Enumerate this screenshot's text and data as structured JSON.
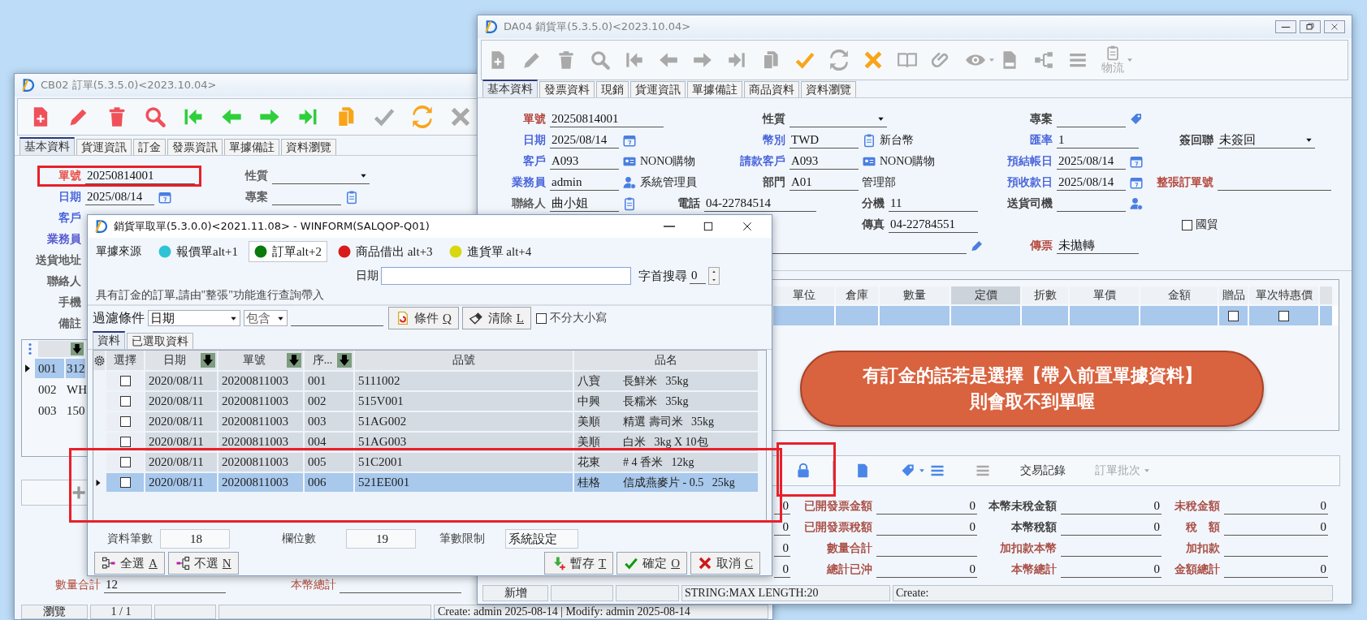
{
  "order_window": {
    "title": "CB02 訂單(5.3.5.0)<2023.10.04>",
    "toolbar": [
      {
        "kind": "new",
        "disabled": false
      },
      {
        "kind": "edit",
        "disabled": false
      },
      {
        "kind": "delete",
        "disabled": false
      },
      {
        "kind": "search",
        "disabled": false
      },
      {
        "kind": "first",
        "disabled": false
      },
      {
        "kind": "prev",
        "disabled": false
      },
      {
        "kind": "next",
        "disabled": false
      },
      {
        "kind": "last",
        "disabled": false
      },
      {
        "kind": "copy",
        "disabled": false
      },
      {
        "kind": "confirm",
        "disabled": true
      },
      {
        "kind": "refresh",
        "disabled": false
      },
      {
        "kind": "cancel",
        "disabled": true
      }
    ],
    "tabs": [
      {
        "label": "基本資料",
        "selected": true
      },
      {
        "label": "貨運資訊",
        "selected": false
      },
      {
        "label": "訂金",
        "selected": false
      },
      {
        "label": "發票資訊",
        "selected": false
      },
      {
        "label": "單據備註",
        "selected": false
      },
      {
        "label": "資料瀏覽",
        "selected": false
      }
    ],
    "fields": [
      {
        "kind": "standard",
        "cells": [
          {
            "label": "單號",
            "color": "#e8433a",
            "kind": "text",
            "value": "20250814001",
            "highlighted": true
          },
          {
            "label": "性質",
            "color": "#555555",
            "kind": "select"
          }
        ]
      },
      {
        "kind": "standard",
        "cells": [
          {
            "label": "日期",
            "color": "#3d5bd9",
            "kind": "date",
            "value": "2025/08/14"
          },
          {
            "label": "專案",
            "color": "#555555",
            "kind": "memo"
          }
        ]
      },
      {
        "kind": "standard",
        "cells": [
          {
            "label": "客戶",
            "color": "#3d5bd9",
            "kind": "label"
          }
        ]
      },
      {
        "kind": "standard",
        "cells": [
          {
            "label": "業務員",
            "color": "#4a4fd0",
            "kind": "label"
          }
        ]
      },
      {
        "kind": "standard",
        "cells": [
          {
            "label": "送貨地址",
            "color": "#555555",
            "kind": "label"
          }
        ]
      },
      {
        "kind": "standard",
        "cells": [
          {
            "label": "聯絡人",
            "color": "#555555",
            "kind": "label"
          }
        ]
      },
      {
        "kind": "standard",
        "cells": [
          {
            "label": "手機",
            "color": "#555555",
            "kind": "label"
          }
        ]
      },
      {
        "kind": "standard",
        "cells": [
          {
            "label": "備註",
            "color": "#555555",
            "kind": "label"
          }
        ]
      }
    ],
    "lines": [
      {
        "seq": "001",
        "value": "312",
        "selected": true
      },
      {
        "seq": "002",
        "value": "WH",
        "selected": false
      },
      {
        "seq": "003",
        "value": "150",
        "selected": false
      }
    ],
    "totals": [
      {
        "label": "數量合計",
        "color": "#b04a3a",
        "value": "12"
      },
      {
        "label": "本幣總計",
        "color": "#b04a3a"
      }
    ],
    "status_bar": {
      "mode": "瀏覽",
      "position": "1 / 1",
      "info": "Create: admin 2025-08-14 | Modify: admin 2025-08-14"
    }
  },
  "sales_window": {
    "title": "DA04 銷貨單(5.3.5.0)<2023.10.04>",
    "toolbar": [
      {
        "kind": "new",
        "disabled": true
      },
      {
        "kind": "edit",
        "disabled": true
      },
      {
        "kind": "delete",
        "disabled": true
      },
      {
        "kind": "search",
        "disabled": true
      },
      {
        "kind": "first",
        "disabled": true
      },
      {
        "kind": "prev",
        "disabled": true
      },
      {
        "kind": "next",
        "disabled": true
      },
      {
        "kind": "last",
        "disabled": true
      },
      {
        "kind": "copy",
        "disabled": true
      },
      {
        "kind": "confirm",
        "disabled": false
      },
      {
        "kind": "refresh",
        "disabled": true
      },
      {
        "kind": "cancel",
        "disabled": false
      },
      {
        "kind": "book",
        "disabled": true
      },
      {
        "kind": "clip",
        "disabled": true
      },
      {
        "kind": "view",
        "disabled": true,
        "dropdown": true
      },
      {
        "kind": "xls",
        "disabled": true
      },
      {
        "kind": "tree",
        "disabled": true
      },
      {
        "kind": "list",
        "disabled": true
      },
      {
        "kind": "logistics",
        "disabled": true,
        "dropdown": true,
        "label": "物流"
      }
    ],
    "tabs": [
      {
        "label": "基本資料",
        "selected": true
      },
      {
        "label": "發票資料",
        "selected": false
      },
      {
        "label": "現銷",
        "selected": false
      },
      {
        "label": "貨運資訊",
        "selected": false
      },
      {
        "label": "單據備註",
        "selected": false
      },
      {
        "label": "商品資料",
        "selected": false
      },
      {
        "label": "資料瀏覽",
        "selected": false
      }
    ],
    "fields": [
      {
        "kind": "standard",
        "cells": [
          {
            "label": "單號",
            "color": "#b03a2e",
            "kind": "text",
            "value": "20250814001"
          },
          {
            "label": "性質",
            "color": "#333333",
            "kind": "select"
          },
          {
            "label": "專案",
            "color": "#333333",
            "kind": "project"
          },
          null
        ]
      },
      {
        "kind": "standard",
        "cells": [
          {
            "label": "日期",
            "color": "#3d5bd9",
            "kind": "date",
            "value": "2025/08/14"
          },
          {
            "label": "幣別",
            "color": "#3d5bd9",
            "kind": "memo",
            "value": "TWD",
            "note": "新台幣"
          },
          {
            "label": "匯率",
            "color": "#3d5bd9",
            "kind": "text",
            "value": "1"
          },
          {
            "label": "簽回聯",
            "color": "#333333",
            "kind": "select",
            "value": "未簽回"
          }
        ]
      },
      {
        "kind": "standard",
        "cells": [
          {
            "label": "客戶",
            "color": "#3d5bd9",
            "kind": "lookup",
            "value": "A093",
            "note": "NONO購物"
          },
          {
            "label": "請款客戶",
            "color": "#3d5bd9",
            "kind": "lookup",
            "value": "A093",
            "note": "NONO購物"
          },
          {
            "label": "預結帳日",
            "color": "#3d5bd9",
            "kind": "date",
            "value": "2025/08/14"
          },
          null
        ]
      },
      {
        "kind": "standard",
        "cells": [
          {
            "label": "業務員",
            "color": "#3d5bd9",
            "kind": "user",
            "value": "admin",
            "note": "系統管理員"
          },
          {
            "label": "部門",
            "color": "#333333",
            "kind": "text",
            "value": "A01",
            "note": "管理部"
          },
          {
            "label": "預收款日",
            "color": "#3d5bd9",
            "kind": "date",
            "value": "2025/08/14"
          },
          {
            "label": "整張訂單號",
            "color": "#b03a2e",
            "kind": "text"
          }
        ]
      },
      {
        "kind": "contact",
        "cells": [
          {
            "label": "聯絡人",
            "color": "#555555",
            "kind": "memo",
            "value": "曲小姐"
          },
          {
            "label": "電話",
            "color": "#333333",
            "kind": "text",
            "value": "04-22784514"
          },
          {
            "label": "分機",
            "color": "#333333",
            "kind": "text",
            "value": "11"
          },
          {
            "label": "送貨司機",
            "color": "#333333",
            "kind": "user"
          }
        ]
      },
      {
        "kind": "contact",
        "cells": [
          null,
          null,
          {
            "label": "傳真",
            "color": "#333333",
            "kind": "text",
            "value": "04-22784551"
          },
          {
            "label": "國貿",
            "color": "#333333",
            "kind": "checkbox",
            "checked": false
          }
        ]
      },
      {
        "kind": "standard",
        "cells": [
          null,
          {
            "kind": "address"
          },
          {
            "label": "傳票",
            "color": "#b03a2e",
            "kind": "text",
            "value": "未拋轉"
          },
          null
        ]
      }
    ],
    "grid": {
      "columns": [
        {
          "label": "單位",
          "kind": "text",
          "selected": false
        },
        {
          "label": "倉庫",
          "kind": "text",
          "selected": false
        },
        {
          "label": "數量",
          "kind": "text",
          "selected": false
        },
        {
          "label": "定價",
          "kind": "text",
          "selected": true
        },
        {
          "label": "折數",
          "kind": "text",
          "selected": false
        },
        {
          "label": "單價",
          "kind": "text",
          "selected": false
        },
        {
          "label": "金額",
          "kind": "text",
          "selected": false
        },
        {
          "label": "贈品",
          "kind": "check",
          "selected": false
        },
        {
          "label": "單次特惠價",
          "kind": "check",
          "selected": false
        }
      ],
      "rows": [
        {
          "selected": true,
          "checks": [
            {
              "checked": false
            },
            {
              "checked": false
            }
          ]
        }
      ]
    },
    "bottom_toolbar": [
      {
        "kind": "lock",
        "disabled": false,
        "highlighted": true
      },
      {
        "kind": "doc",
        "disabled": false
      },
      {
        "kind": "tag",
        "disabled": false,
        "dropdown": true
      },
      {
        "kind": "list",
        "disabled": false
      },
      {
        "kind": "list",
        "disabled": true
      },
      {
        "kind": "text",
        "label": "交易記錄",
        "disabled": false
      },
      {
        "kind": "text",
        "label": "訂單批次",
        "disabled": true,
        "dropdown": true
      }
    ],
    "totals": {
      "column_1": [
        "0",
        "0",
        "0",
        "0"
      ],
      "rows": [
        [
          {
            "label": "已開發票金額",
            "color": "#a5443a",
            "value": "0"
          },
          {
            "label": "本幣未稅金額",
            "color": "#333333",
            "value": "0"
          },
          {
            "label": "未稅金額",
            "color": "#a5443a",
            "value": "0"
          }
        ],
        [
          {
            "label": "已開發票稅額",
            "color": "#a5443a",
            "value": "0"
          },
          {
            "label": "本幣稅額",
            "color": "#333333",
            "value": "0"
          },
          {
            "label": "稅　額",
            "color": "#a5443a",
            "value": "0"
          }
        ],
        [
          {
            "label": "數量合計",
            "color": "#a5443a"
          },
          {
            "label": "加扣款本幣",
            "color": "#a5443a"
          },
          {
            "label": "加扣款",
            "color": "#a5443a"
          }
        ],
        [
          {
            "label": "總計已沖",
            "color": "#a5443a",
            "value": "0"
          },
          {
            "label": "本幣總計",
            "color": "#a5443a",
            "value": "0"
          },
          {
            "label": "金額總計",
            "color": "#a5443a",
            "value": "0"
          }
        ]
      ]
    },
    "status_bar": {
      "mode": "新增",
      "message": "STRING:MAX LENGTH:20",
      "info": "Create:"
    }
  },
  "pick_dialog": {
    "title": "銷貨單取單(5.3.0.0)<2021.11.08> - WINFORM(SALQOP-Q01)",
    "source_label": "單據來源",
    "sources": [
      {
        "label": "報價單alt+1",
        "color": "#2ec4d6",
        "selected": false
      },
      {
        "label": "訂單alt+2",
        "color": "#0a7a0a",
        "selected": true
      },
      {
        "label": "商品借出 alt+3",
        "color": "#d81c1c",
        "selected": false
      },
      {
        "label": "進貨單 alt+4",
        "color": "#d8d810",
        "selected": false
      }
    ],
    "date_label": "日期",
    "prefix_search": {
      "label": "字首搜尋",
      "value": "0"
    },
    "note": "具有訂金的訂單,請由\"整張\"功能進行查詢帶入",
    "filter": {
      "label": "過濾條件",
      "field": "日期",
      "operator": "包含",
      "buttons": [
        {
          "kind": "condition",
          "label": "條件",
          "accel": "Q"
        },
        {
          "kind": "clear",
          "label": "清除",
          "accel": "L"
        }
      ],
      "ignore_case": {
        "label": "不分大小寫",
        "checked": false
      }
    },
    "tabs": [
      {
        "label": "資料",
        "selected": true
      },
      {
        "label": "已選取資料",
        "selected": false
      }
    ],
    "columns": [
      {
        "label": "選擇",
        "sortable": false
      },
      {
        "label": "日期",
        "sortable": true
      },
      {
        "label": "單號",
        "sortable": true
      },
      {
        "label": "序...",
        "sortable": true
      },
      {
        "label": "品號",
        "sortable": false
      },
      {
        "label": "品名",
        "sortable": false
      }
    ],
    "rows": [
      {
        "checked": false,
        "selected": false,
        "date": "2020/08/11",
        "order_no": "20200811003",
        "seq": "001",
        "item_no": "5111002",
        "brand": "八寶",
        "description": "長鮮米   35kg"
      },
      {
        "checked": false,
        "selected": false,
        "date": "2020/08/11",
        "order_no": "20200811003",
        "seq": "002",
        "item_no": "515V001",
        "brand": "中興",
        "description": "長糯米   35kg"
      },
      {
        "checked": false,
        "selected": false,
        "date": "2020/08/11",
        "order_no": "20200811003",
        "seq": "003",
        "item_no": "51AG002",
        "brand": "美順",
        "description": "精選 壽司米   35kg"
      },
      {
        "checked": false,
        "selected": false,
        "date": "2020/08/11",
        "order_no": "20200811003",
        "seq": "004",
        "item_no": "51AG003",
        "brand": "美順",
        "description": "白米   3kg X 10包"
      },
      {
        "checked": false,
        "selected": false,
        "highlighted": true,
        "date": "2020/08/11",
        "order_no": "20200811003",
        "seq": "005",
        "item_no": "51C2001",
        "brand": "花東",
        "description": "# 4 香米   12kg"
      },
      {
        "checked": false,
        "selected": true,
        "highlighted": true,
        "date": "2020/08/11",
        "order_no": "20200811003",
        "seq": "006",
        "item_no": "521EE001",
        "brand": "桂格",
        "description": "信成燕麥片 - 0.5   25kg"
      }
    ],
    "stats": [
      {
        "label": "資料筆數",
        "value": "18"
      },
      {
        "label": "欄位數",
        "value": "19"
      },
      {
        "label": "筆數限制",
        "value": "系統設定"
      }
    ],
    "left_buttons": [
      {
        "kind": "select-all",
        "label": "全選",
        "accel": "A"
      },
      {
        "kind": "select-none",
        "label": "不選",
        "accel": "N"
      }
    ],
    "right_buttons": [
      {
        "kind": "save",
        "label": "暫存",
        "accel": "T"
      },
      {
        "kind": "ok",
        "label": "確定",
        "accel": "O"
      },
      {
        "kind": "cancel",
        "label": "取消",
        "accel": "C"
      }
    ]
  },
  "callout": {
    "lines": [
      "有訂金的話若是選擇【帶入前置單據資料】",
      "則會取不到單喔"
    ]
  }
}
